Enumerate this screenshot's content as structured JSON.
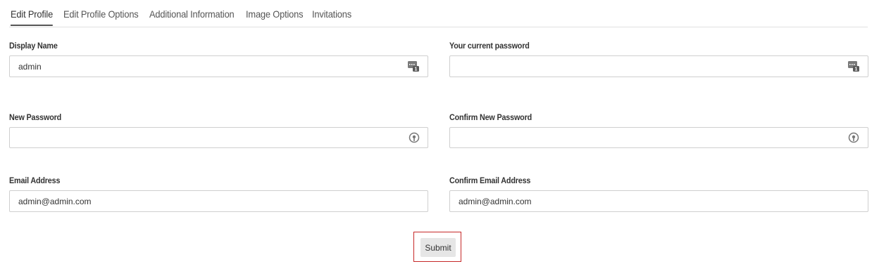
{
  "tabs": [
    {
      "label": "Edit Profile",
      "active": true
    },
    {
      "label": "Edit Profile Options",
      "active": false
    },
    {
      "label": "Additional Information",
      "active": false
    },
    {
      "label": "Image Options",
      "active": false
    },
    {
      "label": "Invitations",
      "active": false
    }
  ],
  "form": {
    "display_name": {
      "label": "Display Name",
      "value": "admin",
      "placeholder": "",
      "icon": "password-manager-icon"
    },
    "current_password": {
      "label": "Your current password",
      "value": "",
      "placeholder": "",
      "icon": "password-manager-icon"
    },
    "new_password": {
      "label": "New Password",
      "value": "",
      "placeholder": "",
      "icon": "key-icon"
    },
    "confirm_new_password": {
      "label": "Confirm New Password",
      "value": "",
      "placeholder": "",
      "icon": "key-icon"
    },
    "email": {
      "label": "Email Address",
      "value": "admin@admin.com",
      "placeholder": ""
    },
    "confirm_email": {
      "label": "Confirm Email Address",
      "value": "admin@admin.com",
      "placeholder": ""
    }
  },
  "submit_label": "Submit",
  "colors": {
    "highlight_border": "#c62828",
    "button_bg": "#e6e6e6",
    "input_border": "#cfcfcf"
  }
}
